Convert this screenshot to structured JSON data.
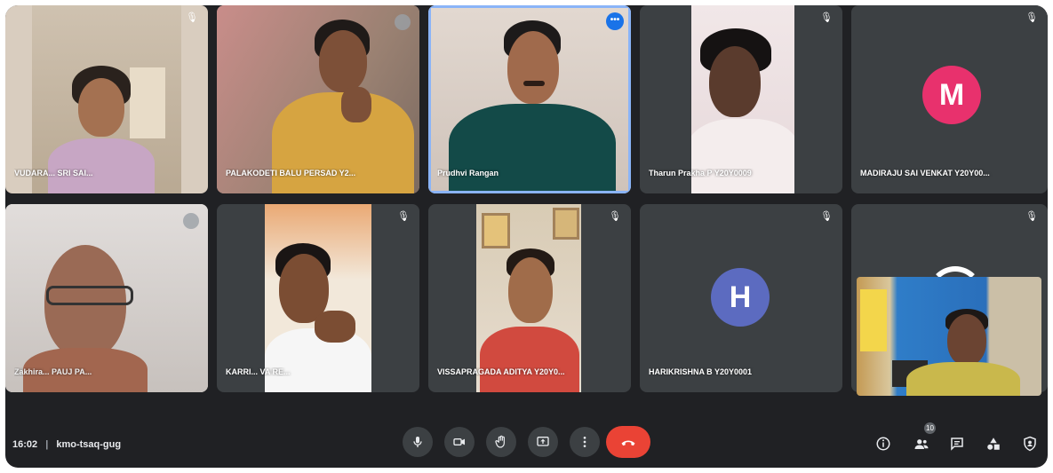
{
  "meeting": {
    "time": "16:02",
    "separator": "|",
    "code": "kmo-tsaq-gug"
  },
  "colors": {
    "background": "#202124",
    "tile": "#3c4043",
    "hangup": "#ea4335",
    "active_outline": "#8ab4f8"
  },
  "participants": [
    {
      "name": "VUDARA... SRI SAI..."
    },
    {
      "name": "PALAKODETI BALU PERSAD Y2..."
    },
    {
      "name": "Prudhvi Rangan"
    },
    {
      "name": "Tharun Prakha P Y20Y0009"
    },
    {
      "name": "MADIRAJU SAI VENKAT Y20Y00...",
      "avatar_letter": "M",
      "avatar_color": "#e8316d"
    },
    {
      "name": "Zakhira... PAUJ PA..."
    },
    {
      "name": "KARRI... VA RE..."
    },
    {
      "name": "VISSAPRAGADA ADITYA Y20Y0..."
    },
    {
      "name": "HARIKRISHNA B Y20Y0001",
      "avatar_letter": "H",
      "avatar_color": "#5c6bc0"
    },
    {
      "name": ""
    }
  ],
  "more_options_label": "•••",
  "controls": {
    "mic": "microphone-icon",
    "camera": "camera-icon",
    "hand": "raise-hand-icon",
    "present": "present-screen-icon",
    "more": "more-options-icon",
    "end": "hang-up-icon"
  },
  "right_controls": {
    "info": "meeting-details-icon",
    "people": "people-icon",
    "people_badge": "10",
    "chat": "chat-icon",
    "activities": "activities-icon",
    "host": "host-controls-icon"
  }
}
